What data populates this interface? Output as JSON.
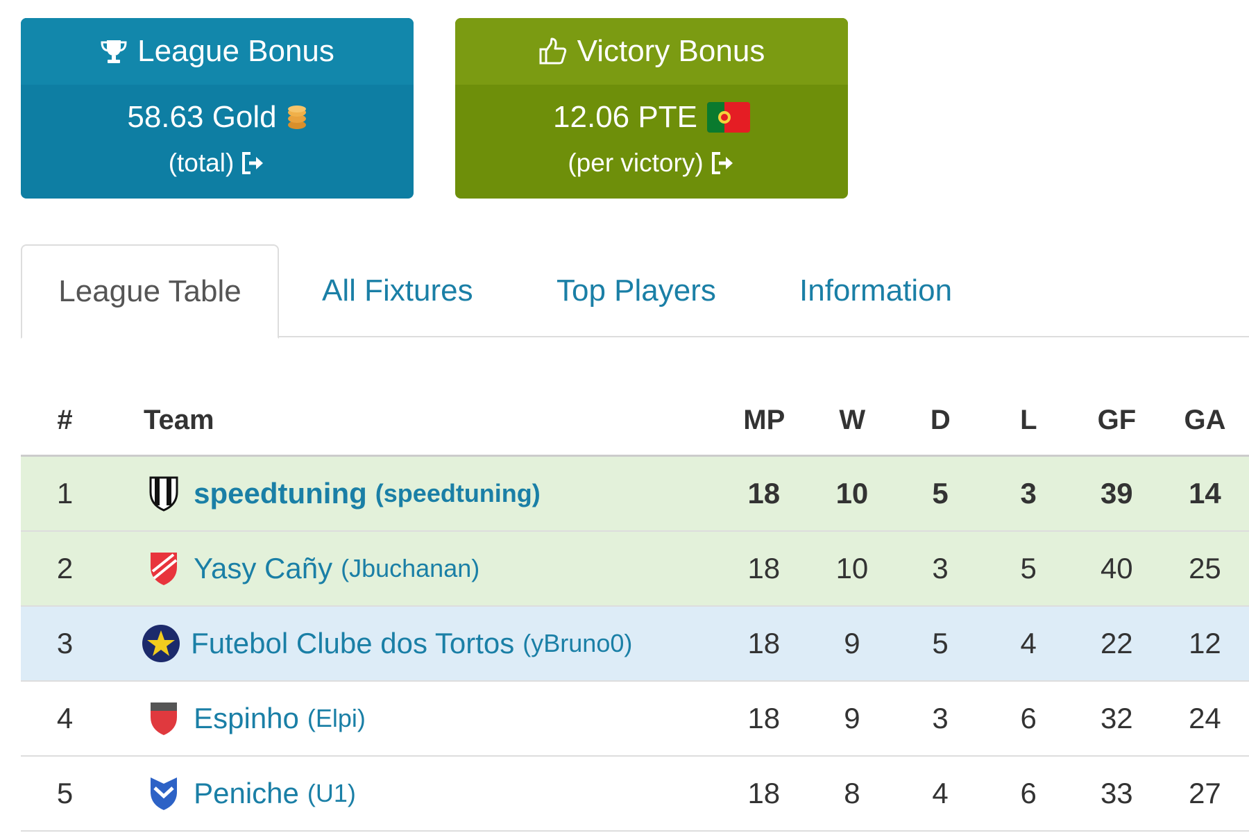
{
  "league_bonus": {
    "title": "League Bonus",
    "value": "58.63 Gold",
    "note": "(total)",
    "icon": "trophy-icon",
    "color": "#1287ab"
  },
  "victory_bonus": {
    "title": "Victory Bonus",
    "value": "12.06 PTE",
    "note": "(per victory)",
    "icon": "thumbs-up-icon",
    "color": "#7b9b12"
  },
  "tabs": [
    {
      "label": "League Table",
      "active": true
    },
    {
      "label": "All Fixtures",
      "active": false
    },
    {
      "label": "Top Players",
      "active": false
    },
    {
      "label": "Information",
      "active": false
    }
  ],
  "table": {
    "headers": [
      "#",
      "Team",
      "MP",
      "W",
      "D",
      "L",
      "GF",
      "GA"
    ],
    "rows": [
      {
        "pos": "1",
        "team": "speedtuning",
        "owner": "(speedtuning)",
        "mp": "18",
        "w": "10",
        "d": "5",
        "l": "3",
        "gf": "39",
        "ga": "14"
      },
      {
        "pos": "2",
        "team": "Yasy Cañy",
        "owner": "(Jbuchanan)",
        "mp": "18",
        "w": "10",
        "d": "3",
        "l": "5",
        "gf": "40",
        "ga": "25"
      },
      {
        "pos": "3",
        "team": "Futebol Clube dos Tortos",
        "owner": "(yBruno0)",
        "mp": "18",
        "w": "9",
        "d": "5",
        "l": "4",
        "gf": "22",
        "ga": "12"
      },
      {
        "pos": "4",
        "team": "Espinho",
        "owner": "(Elpi)",
        "mp": "18",
        "w": "9",
        "d": "3",
        "l": "6",
        "gf": "32",
        "ga": "24"
      },
      {
        "pos": "5",
        "team": "Peniche",
        "owner": "(U1)",
        "mp": "18",
        "w": "8",
        "d": "4",
        "l": "6",
        "gf": "33",
        "ga": "27"
      }
    ]
  },
  "colors": {
    "promotion_row": "#e3f1da",
    "cup_row": "#ddecf7",
    "link": "#1a7fa6"
  }
}
